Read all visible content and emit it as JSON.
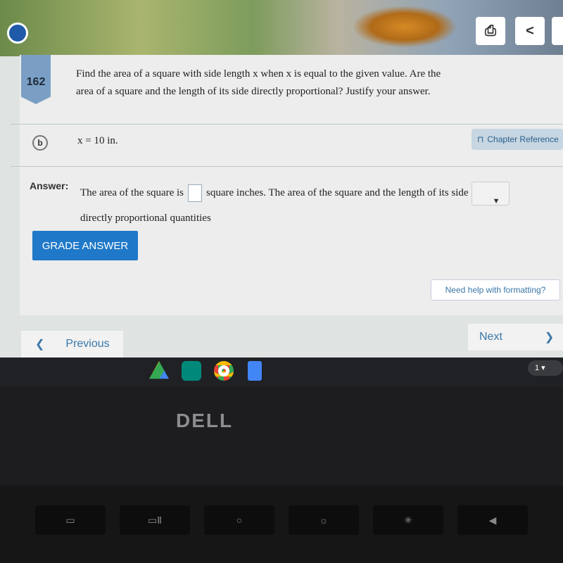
{
  "toolbar": {
    "print_icon": "print-icon",
    "back_label": "<"
  },
  "question": {
    "number": "162",
    "text": "Find the area of a square with side length x  when x is equal to the given value. Are the area of a square and the length of its side directly proportional? Justify your answer.",
    "part": "b",
    "given": "x = 10 in.",
    "chapter_reference": "Chapter Reference"
  },
  "answer": {
    "label": "Answer:",
    "before": "The area of the square is",
    "middle": "square inches. The area of the square and the length of its side",
    "after": "directly proportional quantities",
    "input_value": "",
    "dropdown_value": ""
  },
  "buttons": {
    "grade": "GRADE ANSWER",
    "help": "Need help with formatting?",
    "previous": "Previous",
    "next": "Next"
  },
  "taskbar": {
    "apps": [
      "google-drive",
      "google-meet",
      "chrome",
      "google-docs"
    ],
    "notification_count": "1"
  },
  "laptop": {
    "brand": "DELL"
  }
}
